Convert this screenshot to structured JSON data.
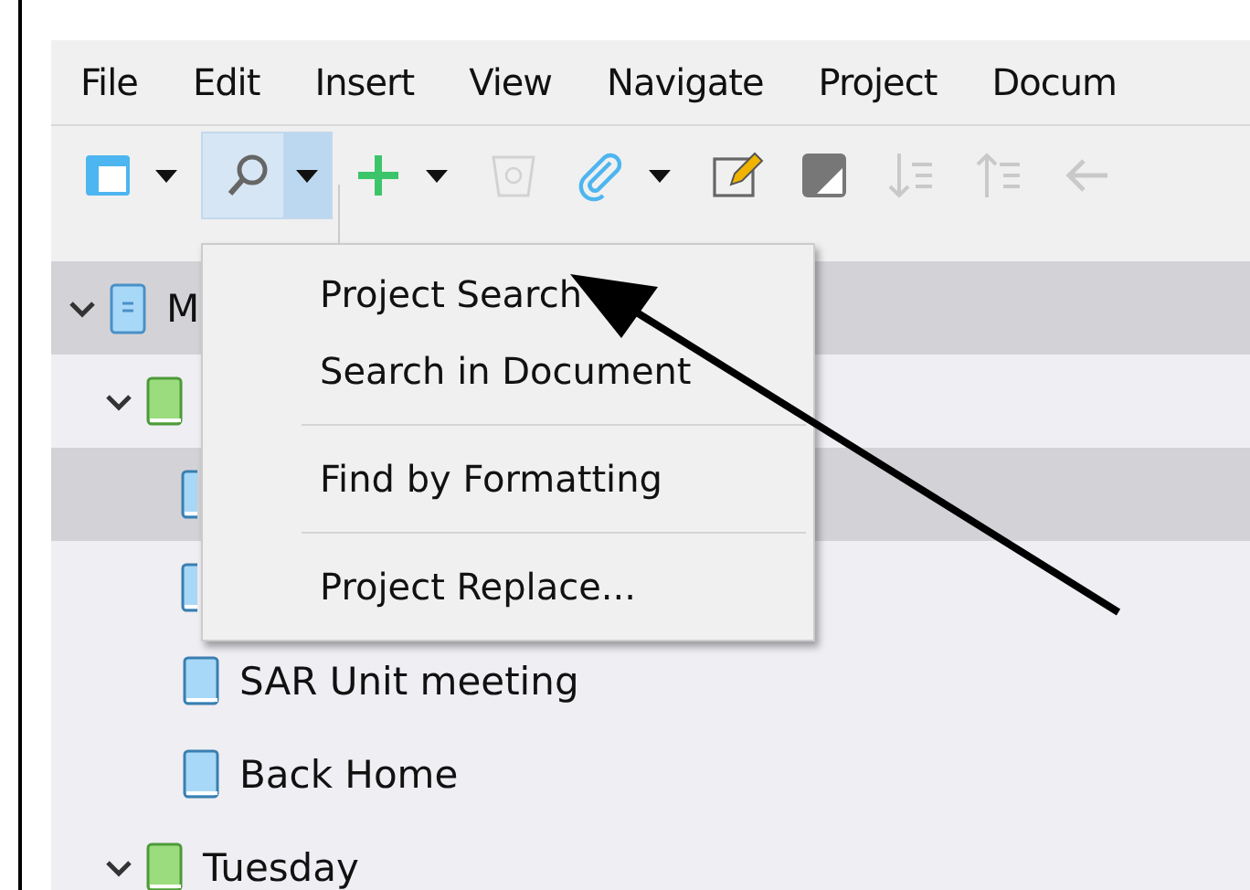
{
  "menu_bar": [
    {
      "label": "File"
    },
    {
      "label": "Edit"
    },
    {
      "label": "Insert"
    },
    {
      "label": "View"
    },
    {
      "label": "Navigate"
    },
    {
      "label": "Project"
    },
    {
      "label": "Docum"
    }
  ],
  "toolbar": [
    {
      "kind": "layout",
      "pressed": false,
      "disabled": false,
      "dropdown": true
    },
    {
      "kind": "search",
      "pressed": true,
      "disabled": false,
      "dropdown": true
    },
    {
      "kind": "add",
      "pressed": false,
      "disabled": false,
      "dropdown": true
    },
    {
      "kind": "trash",
      "pressed": false,
      "disabled": true,
      "dropdown": false
    },
    {
      "kind": "attach",
      "pressed": false,
      "disabled": false,
      "dropdown": true
    },
    {
      "kind": "edit",
      "pressed": false,
      "disabled": false,
      "dropdown": false
    },
    {
      "kind": "contrast",
      "pressed": false,
      "disabled": false,
      "dropdown": false
    },
    {
      "kind": "move-down",
      "pressed": false,
      "disabled": true,
      "dropdown": false
    },
    {
      "kind": "move-up",
      "pressed": false,
      "disabled": true,
      "dropdown": false
    },
    {
      "kind": "back",
      "pressed": false,
      "disabled": true,
      "dropdown": false
    }
  ],
  "tree": [
    {
      "label": "M",
      "kind": "document",
      "expanded": true,
      "selected": true,
      "children": [
        {
          "kind": "green-book",
          "expanded": true,
          "selected": false,
          "children": [
            {
              "kind": "blue-book",
              "selected": true
            },
            {
              "kind": "blue-book",
              "selected": false
            },
            {
              "label": "SAR Unit meeting",
              "kind": "blue-book",
              "selected": false
            },
            {
              "label": "Back Home",
              "kind": "blue-book",
              "selected": false
            }
          ]
        },
        {
          "label": "Tuesday",
          "kind": "green-book",
          "expanded": true,
          "selected": false
        }
      ]
    }
  ],
  "dropdown_menu": [
    [
      {
        "label": "Project Search"
      },
      {
        "label": "Search in Document"
      }
    ],
    [
      {
        "label": "Find by Formatting"
      }
    ],
    [
      {
        "label": "Project Replace..."
      }
    ]
  ]
}
